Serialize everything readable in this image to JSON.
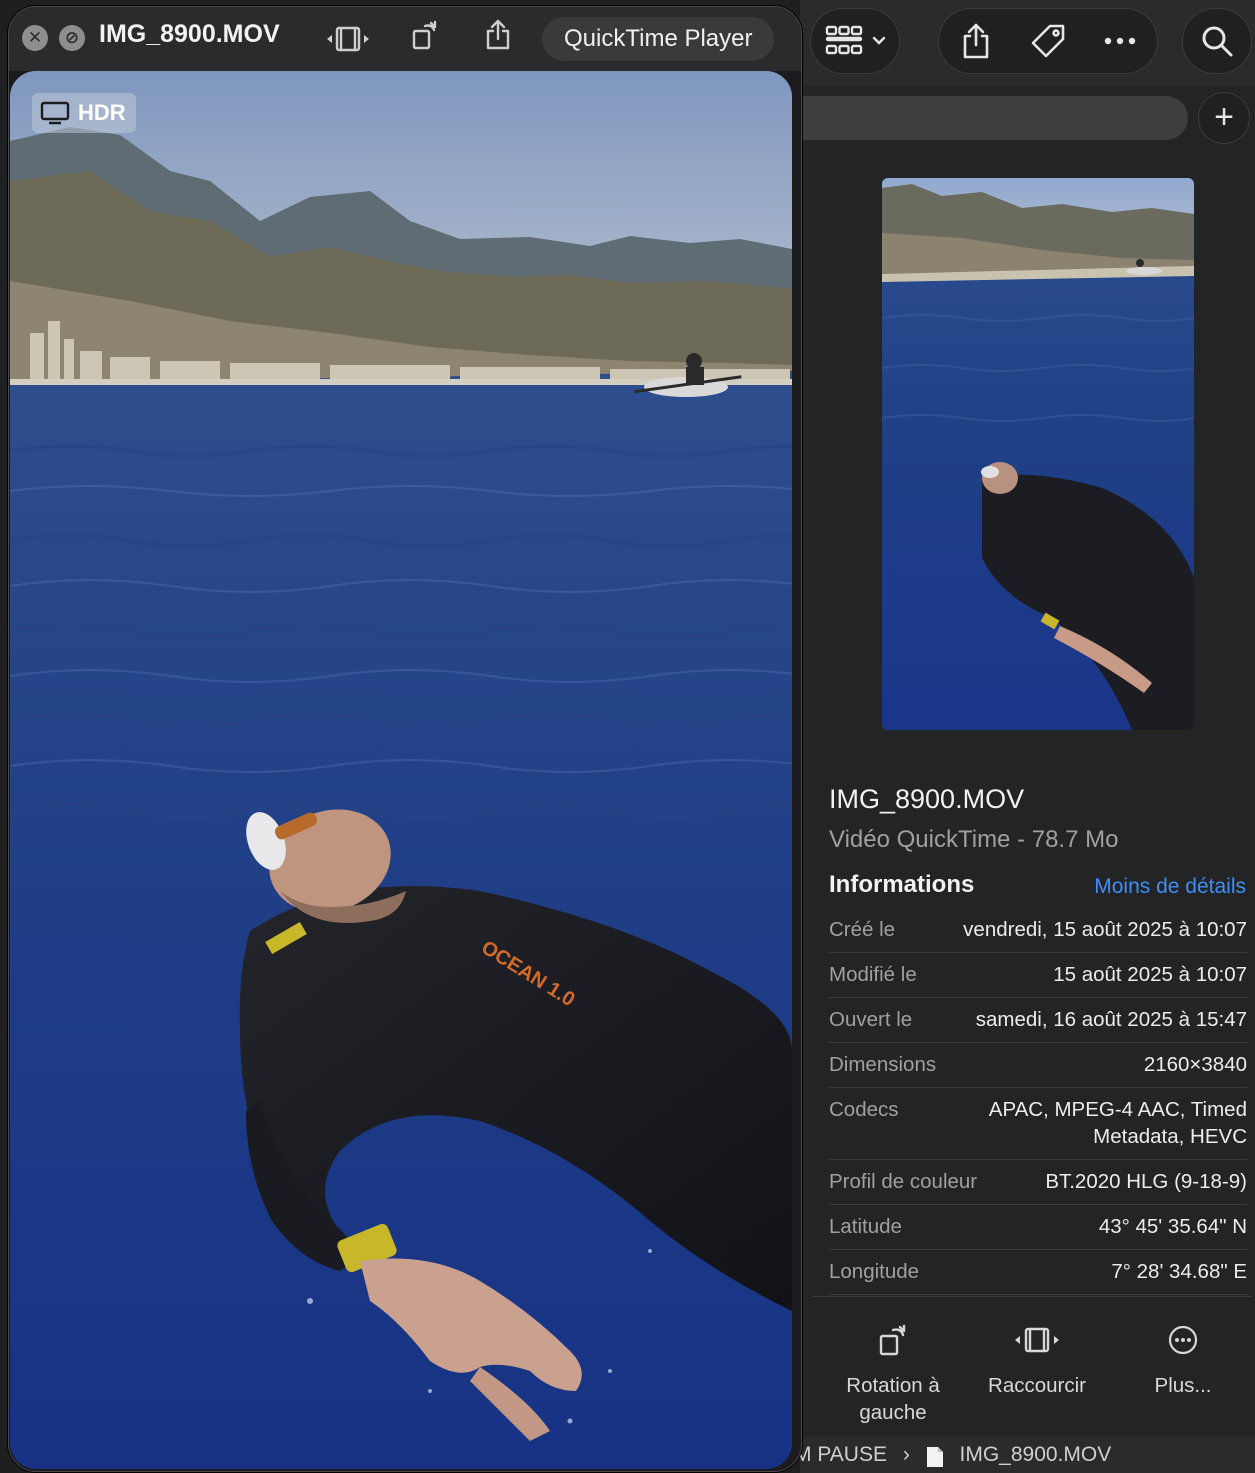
{
  "quicktime": {
    "file_title": "IMG_8900.MOV",
    "app_label": "QuickTime Player",
    "hdr_label": "HDR",
    "close_glyph": "✕",
    "minimize_glyph": "⊘"
  },
  "finder": {
    "preview_alt": "",
    "file_name": "IMG_8900.MOV",
    "file_kind": "Vidéo QuickTime - 78.7 Mo",
    "info_title": "Informations",
    "less_details": "Moins de détails",
    "rows": [
      {
        "key": "Créé le",
        "value": "vendredi, 15 août 2025 à 10:07"
      },
      {
        "key": "Modifié le",
        "value": "15 août 2025 à 10:07"
      },
      {
        "key": "Ouvert le",
        "value": "samedi, 16 août 2025 à 15:47"
      },
      {
        "key": "Dimensions",
        "value": "2160×3840"
      },
      {
        "key": "Codecs",
        "value": "APAC, MPEG-4 AAC, Timed Metadata, HEVC"
      },
      {
        "key": "Profil de couleur",
        "value": "BT.2020 HLG (9-18-9)"
      },
      {
        "key": "Latitude",
        "value": "43° 45' 35.64\" N"
      },
      {
        "key": "Longitude",
        "value": "7° 28' 34.68\" E"
      }
    ],
    "actions": [
      {
        "label": "Rotation à gauche",
        "icon": "rotate-left-icon"
      },
      {
        "label": "Raccourcir",
        "icon": "trim-icon"
      },
      {
        "label": "Plus...",
        "icon": "more-circle-icon"
      }
    ],
    "plus_glyph": "+",
    "pathbar": {
      "folder": "M PAUSE",
      "separator": "›",
      "file": "IMG_8900.MOV"
    }
  }
}
